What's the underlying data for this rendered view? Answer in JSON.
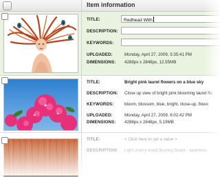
{
  "header": {
    "title": "Item information"
  },
  "items": [
    {
      "title_label": "TITLE:",
      "title_value": "Redhead With",
      "description_label": "DESCRIPTION:",
      "description_value": "",
      "keywords_label": "KEYWORDS:",
      "keywords_value": "",
      "uploaded_label": "UPLOADED:",
      "uploaded_value": "Monday, April 27, 2009, 5:35:41 PM",
      "dimensions_label": "DIMENSIONS:",
      "dimensions_value": "4288px x 2848px, 12.55MB",
      "thumbnail": "redhead-portrait-image"
    },
    {
      "title_label": "TITLE:",
      "title_value": "Bright pink laurel flowers on a blue sky",
      "description_label": "DESCRIPTION:",
      "description_value": "Close up view of bright pink blooming laurel flo",
      "keywords_label": "KEYWORDS:",
      "keywords_value": "bloom, blossom, blue, bright, close-up, flowe",
      "uploaded_label": "UPLOADED:",
      "uploaded_value": "Monday, April 27, 2009, 6:02:42 PM",
      "dimensions_label": "DIMENSIONS:",
      "dimensions_value": "4288px x 2848px, 5.19MB",
      "thumbnail": "pink-flowers-image"
    },
    {
      "title_label": "TITLE:",
      "title_value": "< Click here to set a value >",
      "description_label": "DESCRIPTION:",
      "description_value": "Light cherry wood flooring board - seamless",
      "thumbnail": "wood-texture-image"
    }
  ],
  "colors": {
    "selected_row": "#e9f3df",
    "header_bg": "#ececec"
  }
}
